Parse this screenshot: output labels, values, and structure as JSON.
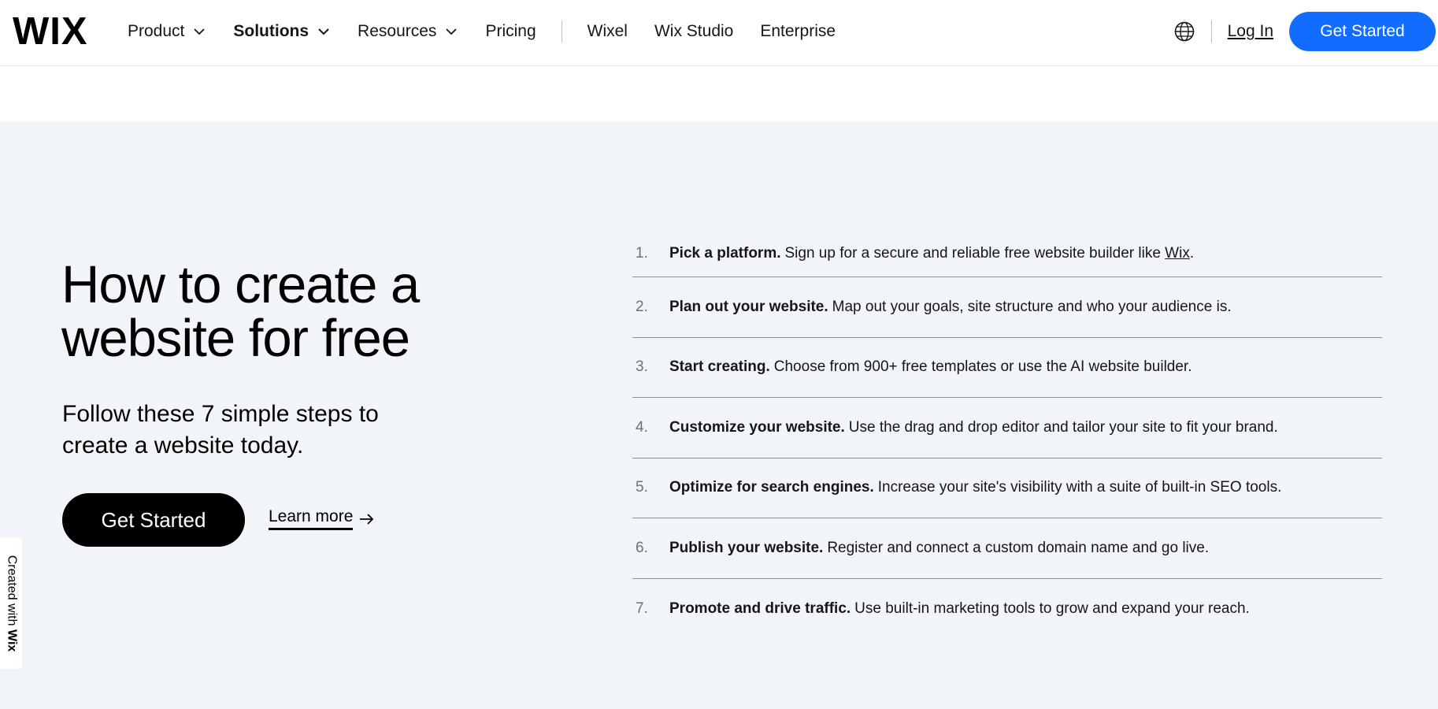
{
  "header": {
    "logo": "WIX",
    "nav": [
      {
        "label": "Product",
        "dropdown": true,
        "bold": false
      },
      {
        "label": "Solutions",
        "dropdown": true,
        "bold": true
      },
      {
        "label": "Resources",
        "dropdown": true,
        "bold": false
      },
      {
        "label": "Pricing",
        "dropdown": false,
        "bold": false
      }
    ],
    "nav_secondary": [
      "Wixel",
      "Wix Studio",
      "Enterprise"
    ],
    "language_icon": "globe-icon",
    "login_label": "Log In",
    "get_started_label": "Get Started",
    "accent_color": "#116dff"
  },
  "hero": {
    "title": "How to create a website for free",
    "subtitle": "Follow these 7 simple steps to create a website today.",
    "cta_label": "Get Started",
    "learn_more_label": "Learn more",
    "background_color": "#f1f4f8"
  },
  "steps": [
    {
      "num": "1.",
      "lead": "Pick a platform.",
      "text": "Sign up for a secure and reliable free website builder like ",
      "link": "Wix",
      "after": "."
    },
    {
      "num": "2.",
      "lead": "Plan out your website.",
      "text": "Map out your goals, site structure and who your audience is."
    },
    {
      "num": "3.",
      "lead": "Start creating.",
      "text": "Choose from 900+ free templates or use the AI website builder."
    },
    {
      "num": "4.",
      "lead": "Customize your website.",
      "text": "Use the drag and drop editor and tailor your site to fit your brand."
    },
    {
      "num": "5.",
      "lead": "Optimize for search engines.",
      "text": "Increase your site's visibility with a suite of built-in SEO tools."
    },
    {
      "num": "6.",
      "lead": "Publish your website.",
      "text": "Register and connect a custom domain name and go live."
    },
    {
      "num": "7.",
      "lead": "Promote and drive traffic.",
      "text": "Use built-in marketing tools to grow and expand your reach."
    }
  ],
  "badge": {
    "prefix": "Created with",
    "brand": "Wix"
  }
}
